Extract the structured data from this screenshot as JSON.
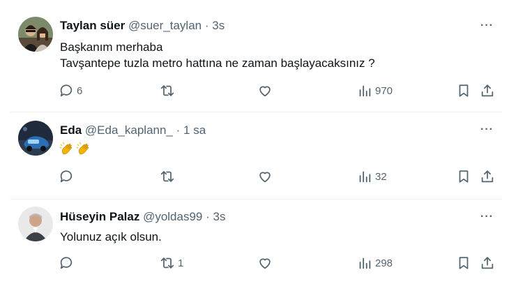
{
  "tweets": [
    {
      "name": "Taylan süer",
      "handle": "@suer_taylan",
      "sep": "·",
      "time": "3s",
      "lines": [
        "Başkanım merhaba",
        "Tavşantepe tuzla metro hattına ne zaman başlayacaksınız ?"
      ],
      "reply_count": "6",
      "retweet_count": "",
      "like_count": "",
      "view_count": "970"
    },
    {
      "name": "Eda",
      "handle": "@Eda_kaplann_",
      "sep": "·",
      "time": "1 sa",
      "emoji": "clapping-hands",
      "reply_count": "",
      "retweet_count": "",
      "like_count": "",
      "view_count": "32"
    },
    {
      "name": "Hüseyin Palaz",
      "handle": "@yoldas99",
      "sep": "·",
      "time": "3s",
      "lines": [
        "Yolunuz açık olsun."
      ],
      "reply_count": "",
      "retweet_count": "1",
      "like_count": "",
      "view_count": "298"
    }
  ],
  "more_label": "···",
  "colors": {
    "text": "#0f1419",
    "muted": "#536471",
    "emoji": "#f4b400"
  }
}
